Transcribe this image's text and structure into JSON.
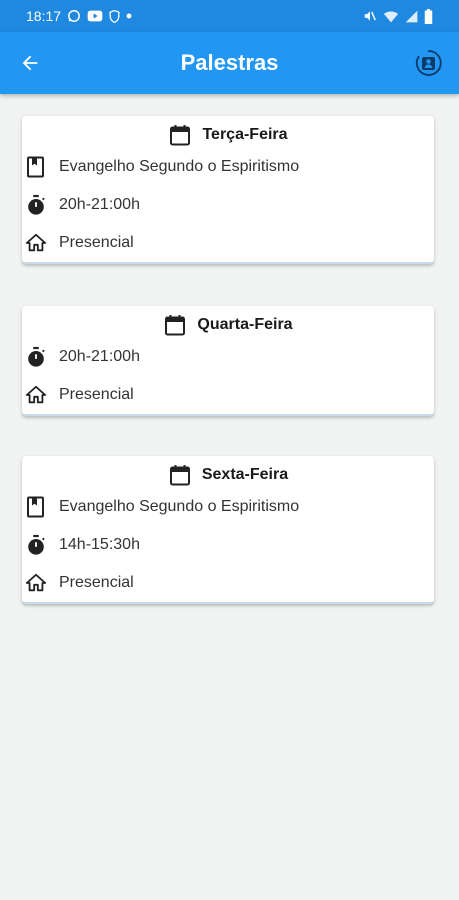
{
  "status_bar": {
    "time": "18:17",
    "left_icons": [
      "whatsapp-icon",
      "youtube-icon",
      "shield-icon",
      "dot-icon"
    ],
    "right_icons": [
      "mute-icon",
      "wifi-icon",
      "signal-icon",
      "battery-icon"
    ]
  },
  "app_bar": {
    "title": "Palestras",
    "back_icon": "arrow-back-icon",
    "action_icon": "account-box-icon"
  },
  "colors": {
    "app_bar": "#2196f3",
    "status_bar": "#1f88e0",
    "background": "#f1f3f2",
    "card": "#ffffff"
  },
  "cards": [
    {
      "day": "Terça-Feira",
      "rows": [
        {
          "icon": "book-icon",
          "text": "Evangelho Segundo o Espiritismo"
        },
        {
          "icon": "timer-icon",
          "text": "20h-21:00h"
        },
        {
          "icon": "home-icon",
          "text": "Presencial"
        }
      ]
    },
    {
      "day": "Quarta-Feira",
      "rows": [
        {
          "icon": "timer-icon",
          "text": "20h-21:00h"
        },
        {
          "icon": "home-icon",
          "text": "Presencial"
        }
      ]
    },
    {
      "day": "Sexta-Feira",
      "rows": [
        {
          "icon": "book-icon",
          "text": "Evangelho Segundo o Espiritismo"
        },
        {
          "icon": "timer-icon",
          "text": "14h-15:30h"
        },
        {
          "icon": "home-icon",
          "text": "Presencial"
        }
      ]
    }
  ]
}
